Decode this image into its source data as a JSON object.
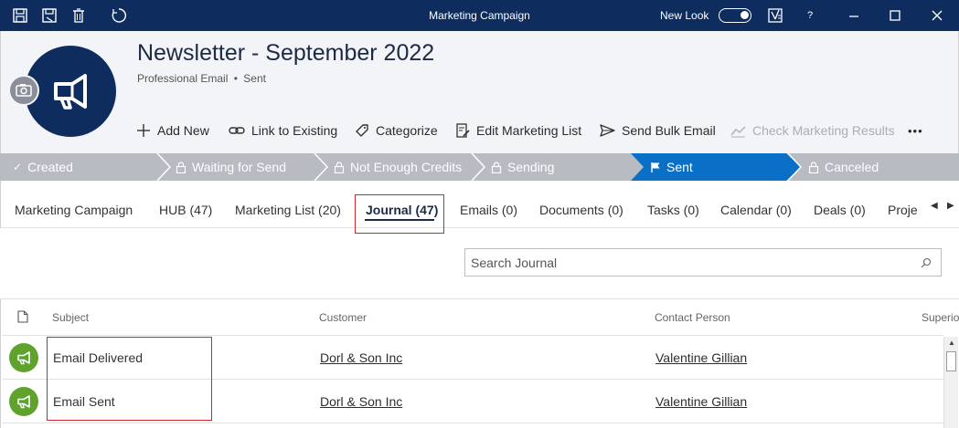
{
  "window": {
    "title": "Marketing Campaign",
    "new_look_label": "New Look",
    "help_label": "?",
    "icons": [
      "save-icon",
      "save-close-icon",
      "delete-icon",
      "refresh-icon",
      "notes-icon",
      "minimize-icon",
      "maximize-icon",
      "close-icon"
    ],
    "title_bar_color": "#0e2d5e"
  },
  "record": {
    "title": "Newsletter - September 2022",
    "type": "Professional Email",
    "separator": "•",
    "status": "Sent",
    "avatar_icon": "megaphone-icon"
  },
  "actions": [
    {
      "label": "Add New",
      "icon": "plus-icon",
      "enabled": true
    },
    {
      "label": "Link to Existing",
      "icon": "link-icon",
      "enabled": true
    },
    {
      "label": "Categorize",
      "icon": "tag-icon",
      "enabled": true
    },
    {
      "label": "Edit Marketing List",
      "icon": "edit-list-icon",
      "enabled": true
    },
    {
      "label": "Send Bulk Email",
      "icon": "send-icon",
      "enabled": true
    },
    {
      "label": "Check Marketing Results",
      "icon": "results-icon",
      "enabled": false
    }
  ],
  "more_label": "•••",
  "process": {
    "steps": [
      {
        "label": "Created",
        "icon": "check-icon",
        "state": "done"
      },
      {
        "label": "Waiting for Send",
        "icon": "lock-icon",
        "state": "locked"
      },
      {
        "label": "Not Enough Credits",
        "icon": "lock-icon",
        "state": "locked"
      },
      {
        "label": "Sending",
        "icon": "lock-icon",
        "state": "locked"
      },
      {
        "label": "Sent",
        "icon": "flag-icon",
        "state": "active"
      },
      {
        "label": "Canceled",
        "icon": "lock-icon",
        "state": "locked"
      }
    ],
    "active_color": "#0a6fc6",
    "inactive_color": "#b8bbc2"
  },
  "tabs": [
    {
      "label": "Marketing Campaign"
    },
    {
      "label": "HUB (47)"
    },
    {
      "label": "Marketing List (20)"
    },
    {
      "label": "Journal (47)",
      "active": true
    },
    {
      "label": "Emails (0)"
    },
    {
      "label": "Documents (0)"
    },
    {
      "label": "Tasks (0)"
    },
    {
      "label": "Calendar (0)"
    },
    {
      "label": "Deals (0)"
    },
    {
      "label": "Proje"
    }
  ],
  "search": {
    "placeholder": "Search Journal"
  },
  "table": {
    "columns": [
      "Subject",
      "Customer",
      "Contact Person",
      "Superio"
    ],
    "rows": [
      {
        "subject": "Email Delivered",
        "customer": "Dorl & Son Inc",
        "contact": "Valentine Gillian",
        "icon": "megaphone-icon"
      },
      {
        "subject": "Email Sent",
        "customer": "Dorl & Son Inc",
        "contact": "Valentine Gillian",
        "icon": "megaphone-icon"
      }
    ]
  },
  "colors": {
    "highlight": "#d1272b",
    "row_badge": "#5fa32e"
  }
}
